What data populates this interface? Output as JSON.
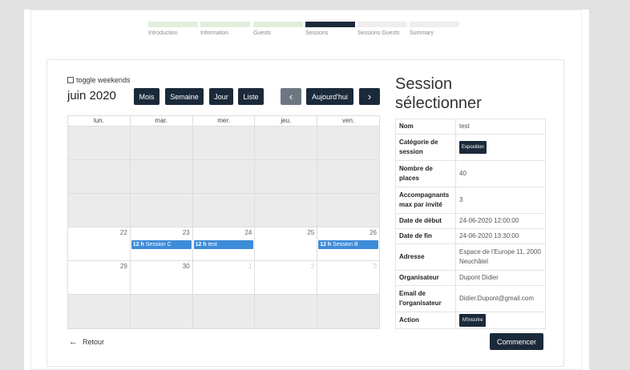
{
  "stepper": [
    {
      "label": "Introduction",
      "state": "done"
    },
    {
      "label": "Information",
      "state": "done"
    },
    {
      "label": "Guests",
      "state": "done"
    },
    {
      "label": "Sessions",
      "state": "active"
    },
    {
      "label": "Sessions Guests",
      "state": "todo"
    },
    {
      "label": "Summary",
      "state": "todo"
    }
  ],
  "toolbar": {
    "toggle_weekends": "toggle weekends",
    "month": "juin 2020",
    "view_month": "Mois",
    "view_week": "Semaine",
    "view_day": "Jour",
    "view_list": "Liste",
    "prev": "‹",
    "today": "Aujourd'hui",
    "next": "›"
  },
  "calendar": {
    "headers": [
      "lun.",
      "mar.",
      "mer.",
      "jeu.",
      "ven."
    ],
    "weeks": [
      {
        "days": [
          "",
          "",
          "",
          "",
          ""
        ],
        "off": [
          true,
          true,
          true,
          true,
          true
        ]
      },
      {
        "days": [
          "",
          "",
          "",
          "",
          ""
        ],
        "off": [
          true,
          true,
          true,
          true,
          true
        ]
      },
      {
        "days": [
          "",
          "",
          "",
          "",
          ""
        ],
        "off": [
          true,
          true,
          true,
          true,
          true
        ]
      },
      {
        "days": [
          "22",
          "23",
          "24",
          "25",
          "26"
        ],
        "off": [
          false,
          false,
          false,
          false,
          false
        ]
      },
      {
        "days": [
          "29",
          "30",
          "1",
          "2",
          "3"
        ],
        "off": [
          false,
          false,
          false,
          false,
          false
        ]
      },
      {
        "days": [
          "",
          "",
          "",
          "",
          ""
        ],
        "off": [
          true,
          true,
          true,
          true,
          true
        ]
      }
    ],
    "events": [
      {
        "col": 1,
        "week": 3,
        "time": "12 h",
        "title": "Session C"
      },
      {
        "col": 2,
        "week": 3,
        "time": "12 h",
        "title": "test"
      },
      {
        "col": 4,
        "week": 3,
        "time": "12 h",
        "title": "Session B"
      }
    ]
  },
  "retour": "Retour",
  "side": {
    "title_line1": "Session",
    "title_line2": "sélectionner",
    "rows": [
      {
        "k": "Nom",
        "v": "test"
      },
      {
        "k": "Catégorie de session",
        "badge": "Exposition"
      },
      {
        "k": "Nombre de places",
        "v": "40"
      },
      {
        "k": "Accompagnants max par invité",
        "v": "3"
      },
      {
        "k": "Date de début",
        "v": "24-06-2020 12:00:00"
      },
      {
        "k": "Date de fin",
        "v": "24-06-2020 13:30:00"
      },
      {
        "k": "Adresse",
        "v": "Espace de l'Europe 11, 2000 Neuchâtel"
      },
      {
        "k": "Organisateur",
        "v": "Dupont Didier"
      },
      {
        "k": "Email de l'organisateur",
        "v": "Didier.Dupont@gmail.com"
      },
      {
        "k": "Action",
        "button": "M'inscrire"
      }
    ],
    "start_button": "Commencer"
  }
}
